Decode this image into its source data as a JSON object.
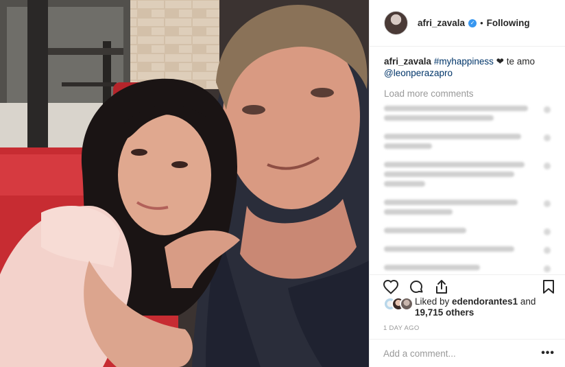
{
  "post": {
    "author": "afri_zavala",
    "follow_status": "Following",
    "separator": "•",
    "verified_mark": "✓"
  },
  "caption": {
    "user": "afri_zavala",
    "hashtag": "#myhappiness",
    "heart": "❤",
    "text": " te amo",
    "mention": "@leonperazapro"
  },
  "comments": {
    "load_more": "Load more comments",
    "blurred_count": 8
  },
  "likes": {
    "prefix": "Liked by ",
    "first_user": "edendorantes1",
    "middle": " and",
    "count": "19,715 others"
  },
  "timestamp": "1 DAY AGO",
  "add_comment": {
    "placeholder": "Add a comment...",
    "more_label": "•••"
  },
  "icons": [
    "heart-icon",
    "comment-icon",
    "share-icon",
    "bookmark-icon"
  ],
  "colors": {
    "link": "#003569",
    "muted": "#999999",
    "verified": "#3897f0",
    "text": "#262626"
  }
}
